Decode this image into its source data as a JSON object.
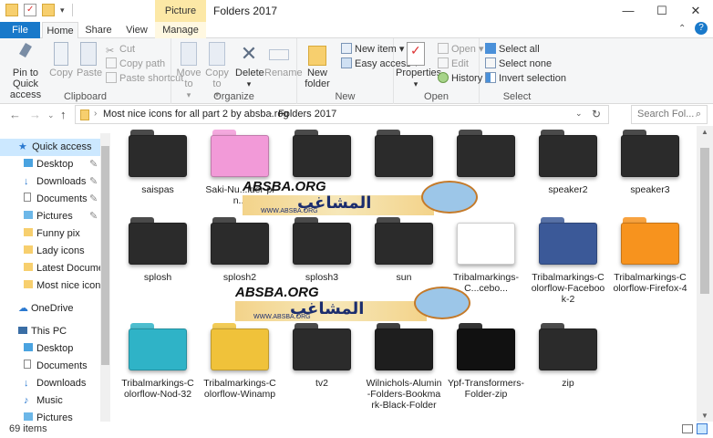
{
  "window": {
    "title": "Folders 2017",
    "tool_tab": "Picture Tools",
    "min_icon": "minimize-icon",
    "max_icon": "maximize-icon",
    "close_icon": "close-icon"
  },
  "tabs": [
    "File",
    "Home",
    "Share",
    "View",
    "Manage"
  ],
  "ribbon": {
    "clipboard": {
      "label": "Clipboard",
      "pin": "Pin to Quick access",
      "copy": "Copy",
      "paste": "Paste",
      "cut": "Cut",
      "copy_path": "Copy path",
      "paste_shortcut": "Paste shortcut"
    },
    "organize": {
      "label": "Organize",
      "move_to": "Move to",
      "copy_to": "Copy to",
      "delete": "Delete",
      "rename": "Rename"
    },
    "new": {
      "label": "New",
      "new_folder": "New folder",
      "new_item": "New item",
      "easy_access": "Easy access"
    },
    "open": {
      "label": "Open",
      "properties": "Properties",
      "open": "Open",
      "edit": "Edit",
      "history": "History"
    },
    "select": {
      "label": "Select",
      "select_all": "Select all",
      "select_none": "Select none",
      "invert": "Invert selection"
    }
  },
  "address": {
    "crumb1": "Most nice icons for all part 2 by absba.rog",
    "crumb2": "Folders 2017",
    "search_placeholder": "Search Fol..."
  },
  "nav": {
    "quick_access": "Quick access",
    "items": [
      {
        "label": "Desktop",
        "pinned": true
      },
      {
        "label": "Downloads",
        "pinned": true
      },
      {
        "label": "Documents",
        "pinned": true
      },
      {
        "label": "Pictures",
        "pinned": true
      },
      {
        "label": "Funny pix",
        "pinned": false
      },
      {
        "label": "Lady icons",
        "pinned": false
      },
      {
        "label": "Latest Document",
        "pinned": false
      },
      {
        "label": "Most nice icons f",
        "pinned": false
      }
    ],
    "onedrive": "OneDrive",
    "this_pc": "This PC",
    "pc_items": [
      "Desktop",
      "Documents",
      "Downloads",
      "Music",
      "Pictures"
    ]
  },
  "files": [
    {
      "label": "saispas",
      "color": "#2b2b2b"
    },
    {
      "label": "Saki-Nu...lder-pin...",
      "color": "#f29ad8"
    },
    {
      "label": "",
      "color": "#2b2b2b"
    },
    {
      "label": "",
      "color": "#2b2b2b"
    },
    {
      "label": "",
      "color": "#2b2b2b"
    },
    {
      "label": "speaker2",
      "color": "#2b2b2b"
    },
    {
      "label": "speaker3",
      "color": "#2b2b2b"
    },
    {
      "label": "splosh",
      "color": "#2b2b2b"
    },
    {
      "label": "splosh2",
      "color": "#2b2b2b"
    },
    {
      "label": "splosh3",
      "color": "#2b2b2b"
    },
    {
      "label": "sun",
      "color": "#2b2b2b"
    },
    {
      "label": "Tribalmarkings-C...cebo...",
      "color": "#ffffff"
    },
    {
      "label": "Tribalmarkings-Colorflow-Facebook-2",
      "color": "#3b5998"
    },
    {
      "label": "Tribalmarkings-Colorflow-Firefox-4",
      "color": "#f7931e"
    },
    {
      "label": "Tribalmarkings-Colorflow-Nod-32",
      "color": "#2fb3c7"
    },
    {
      "label": "Tribalmarkings-Colorflow-Winamp",
      "color": "#f0c23a"
    },
    {
      "label": "tv2",
      "color": "#2b2b2b"
    },
    {
      "label": "Wilnichols-Alumin-Folders-Bookmark-Black-Folder",
      "color": "#1e1e1e"
    },
    {
      "label": "Ypf-Transformers-Folder-zip",
      "color": "#111111"
    },
    {
      "label": "zip",
      "color": "#2b2b2b"
    }
  ],
  "watermark": {
    "latin": "ABSBA.ORG",
    "arabic": "المشاغب",
    "url": "WWW.ABSBA.ORG"
  },
  "status": {
    "count": "69 items"
  }
}
